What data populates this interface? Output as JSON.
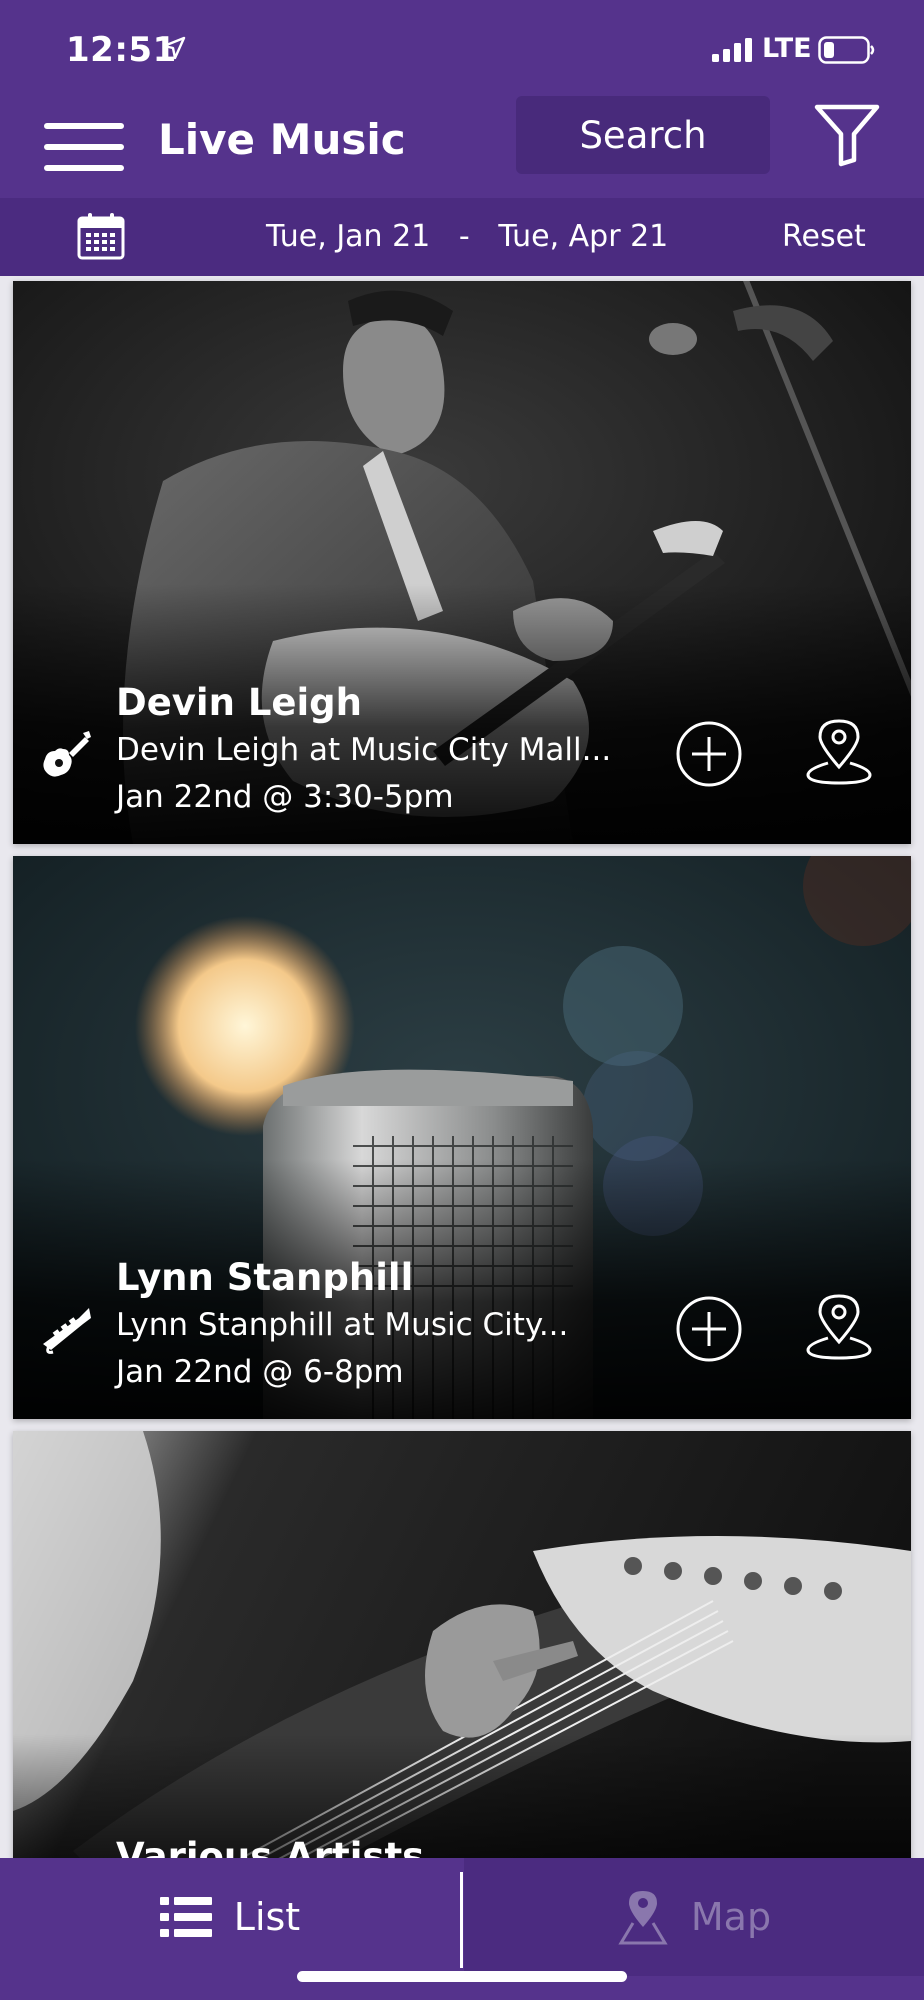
{
  "status_bar": {
    "time": "12:51",
    "network": "LTE"
  },
  "header": {
    "title": "Live Music",
    "search_label": "Search"
  },
  "date_bar": {
    "start": "Tue, Jan 21",
    "separator": "-",
    "end": "Tue, Apr 21",
    "reset_label": "Reset"
  },
  "events": [
    {
      "title": "Devin Leigh",
      "subtitle": "Devin Leigh at Music City Mall...",
      "date": "Jan 22nd @ 3:30-5pm",
      "instrument_icon": "guitar-icon"
    },
    {
      "title": "Lynn Stanphill",
      "subtitle": "Lynn Stanphill at Music City...",
      "date": "Jan 22nd @ 6-8pm",
      "instrument_icon": "trumpet-icon"
    },
    {
      "title": "Various Artists",
      "subtitle": "",
      "date": "",
      "instrument_icon": ""
    }
  ],
  "tabs": {
    "list_label": "List",
    "map_label": "Map",
    "active": "List"
  },
  "colors": {
    "brand_purple": "#55338c",
    "dark_purple": "#4b2b80",
    "search_bg": "#482a7b",
    "inactive_tab_text": "#8a77ad"
  }
}
